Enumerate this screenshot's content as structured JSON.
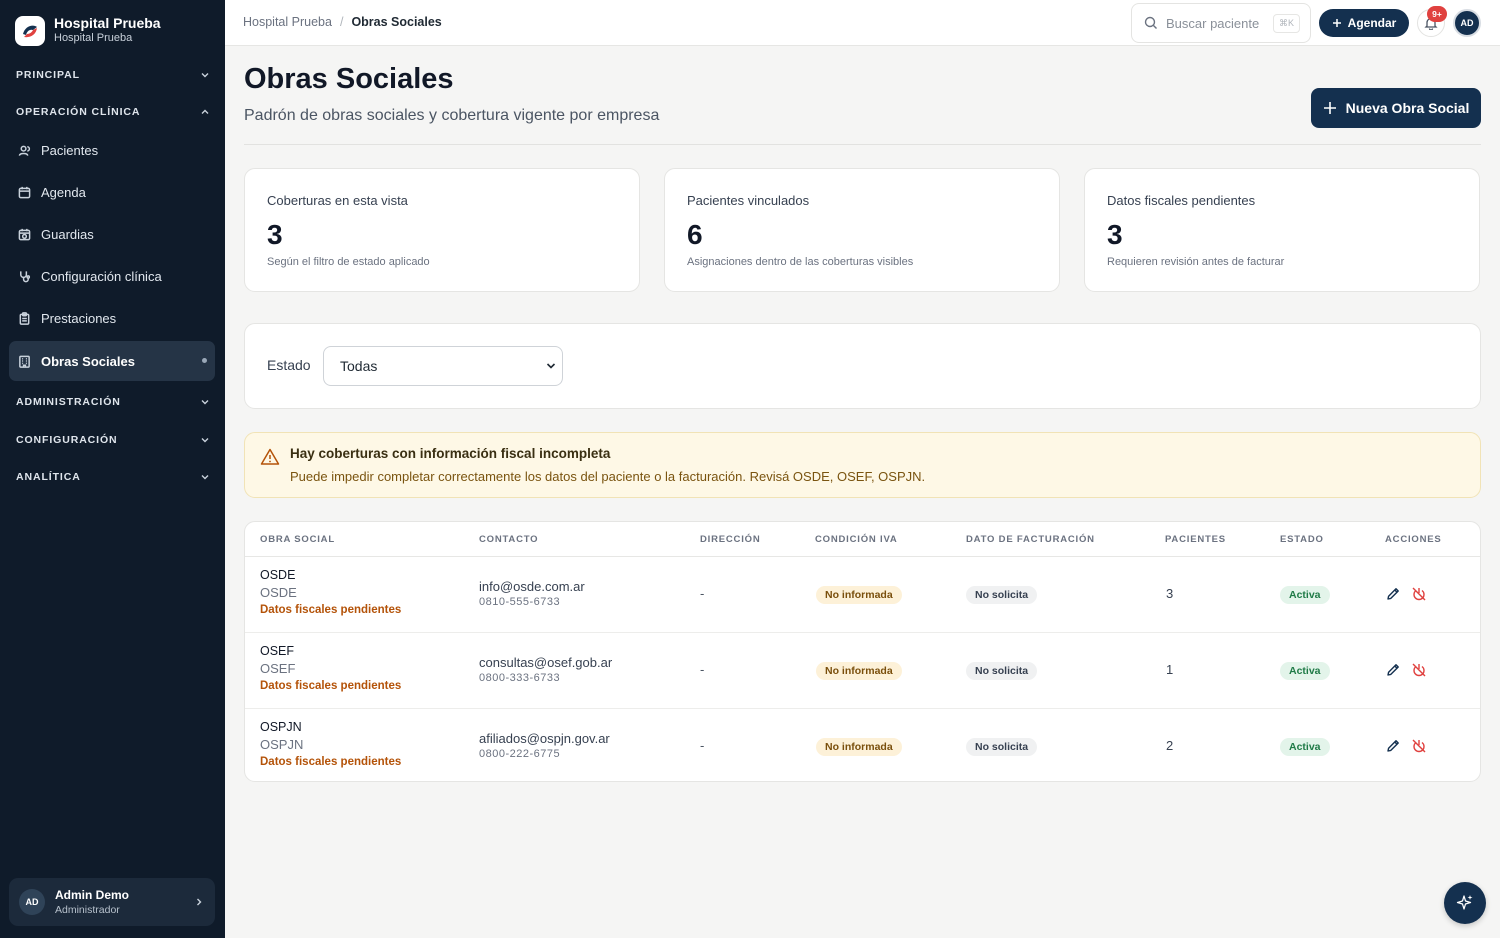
{
  "brand": {
    "title": "Hospital Prueba",
    "subtitle": "Hospital Prueba"
  },
  "sidebar": {
    "sections": {
      "principal": "PRINCIPAL",
      "operacion": "OPERACIÓN CLÍNICA",
      "administracion": "ADMINISTRACIÓN",
      "configuracion": "CONFIGURACIÓN",
      "analitica": "ANALÍTICA"
    },
    "items": [
      {
        "label": "Pacientes",
        "icon": "users-icon"
      },
      {
        "label": "Agenda",
        "icon": "calendar-icon"
      },
      {
        "label": "Guardias",
        "icon": "calendar-clock-icon"
      },
      {
        "label": "Configuración clínica",
        "icon": "stethoscope-icon"
      },
      {
        "label": "Prestaciones",
        "icon": "clipboard-icon"
      },
      {
        "label": "Obras Sociales",
        "icon": "building-icon",
        "active": true
      }
    ],
    "user": {
      "initials": "AD",
      "name": "Admin Demo",
      "role": "Administrador"
    }
  },
  "topbar": {
    "breadcrumb": [
      "Hospital Prueba",
      "/",
      "Obras Sociales"
    ],
    "search_placeholder": "Buscar paciente",
    "search_shortcut": "⌘K",
    "agendar_label": "Agendar",
    "notifications_badge": "9+",
    "avatar_initials": "AD"
  },
  "header": {
    "title": "Obras Sociales",
    "subtitle": "Padrón de obras sociales y cobertura vigente por empresa",
    "new_button": "Nueva Obra Social"
  },
  "stats": [
    {
      "label": "Coberturas en esta vista",
      "value": "3",
      "note": "Según el filtro de estado aplicado"
    },
    {
      "label": "Pacientes vinculados",
      "value": "6",
      "note": "Asignaciones dentro de las coberturas visibles"
    },
    {
      "label": "Datos fiscales pendientes",
      "value": "3",
      "note": "Requieren revisión antes de facturar"
    }
  ],
  "filter": {
    "label": "Estado",
    "selected": "Todas"
  },
  "alert": {
    "title": "Hay coberturas con información fiscal incompleta",
    "text": "Puede impedir completar correctamente los datos del paciente o la facturación. Revisá OSDE, OSEF, OSPJN."
  },
  "table": {
    "columns": [
      "OBRA SOCIAL",
      "CONTACTO",
      "DIRECCIÓN",
      "CONDICIÓN IVA",
      "DATO DE FACTURACIÓN",
      "PACIENTES",
      "ESTADO",
      "ACCIONES"
    ],
    "rows": [
      {
        "name": "OSDE",
        "alias": "OSDE",
        "warning": "Datos fiscales pendientes",
        "email": "info@osde.com.ar",
        "phone": "0810-555-6733",
        "address": "-",
        "iva": "No informada",
        "billing": "No solicita",
        "patients": "3",
        "status": "Activa"
      },
      {
        "name": "OSEF",
        "alias": "OSEF",
        "warning": "Datos fiscales pendientes",
        "email": "consultas@osef.gob.ar",
        "phone": "0800-333-6733",
        "address": "-",
        "iva": "No informada",
        "billing": "No solicita",
        "patients": "1",
        "status": "Activa"
      },
      {
        "name": "OSPJN",
        "alias": "OSPJN",
        "warning": "Datos fiscales pendientes",
        "email": "afiliados@ospjn.gov.ar",
        "phone": "0800-222-6775",
        "address": "-",
        "iva": "No informada",
        "billing": "No solicita",
        "patients": "2",
        "status": "Activa"
      }
    ]
  },
  "colors": {
    "primary": "#14304f",
    "sidebar": "#0f1b2a",
    "warning": "#b45309",
    "success": "#1f7a46",
    "danger": "#e0413f"
  }
}
